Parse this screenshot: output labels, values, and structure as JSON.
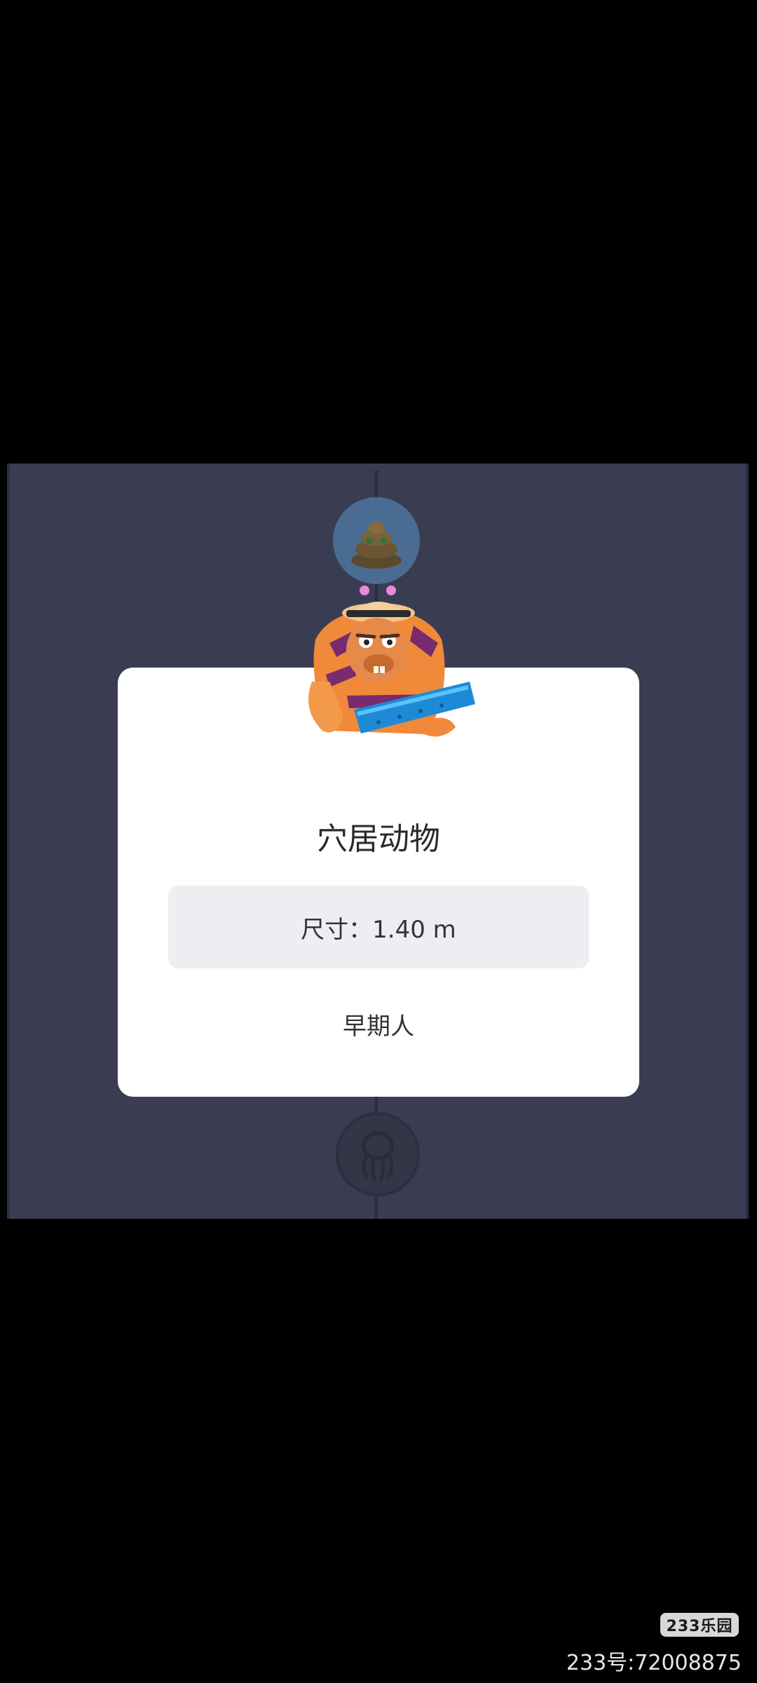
{
  "screen": {
    "background": "#000000",
    "game_background": "#3a3d52",
    "card_background": "#ffffff"
  },
  "map": {
    "top_node_icon": "poop-creature-icon",
    "bottom_node_icon": "octopus-silhouette-icon"
  },
  "creature_card": {
    "portrait_icon": "caveman-character-icon",
    "name": "穴居动物",
    "size_text": "尺寸：1.40 m",
    "era": "早期人"
  },
  "watermark": {
    "badge": "233乐园",
    "id_text": "233号:72008875"
  }
}
